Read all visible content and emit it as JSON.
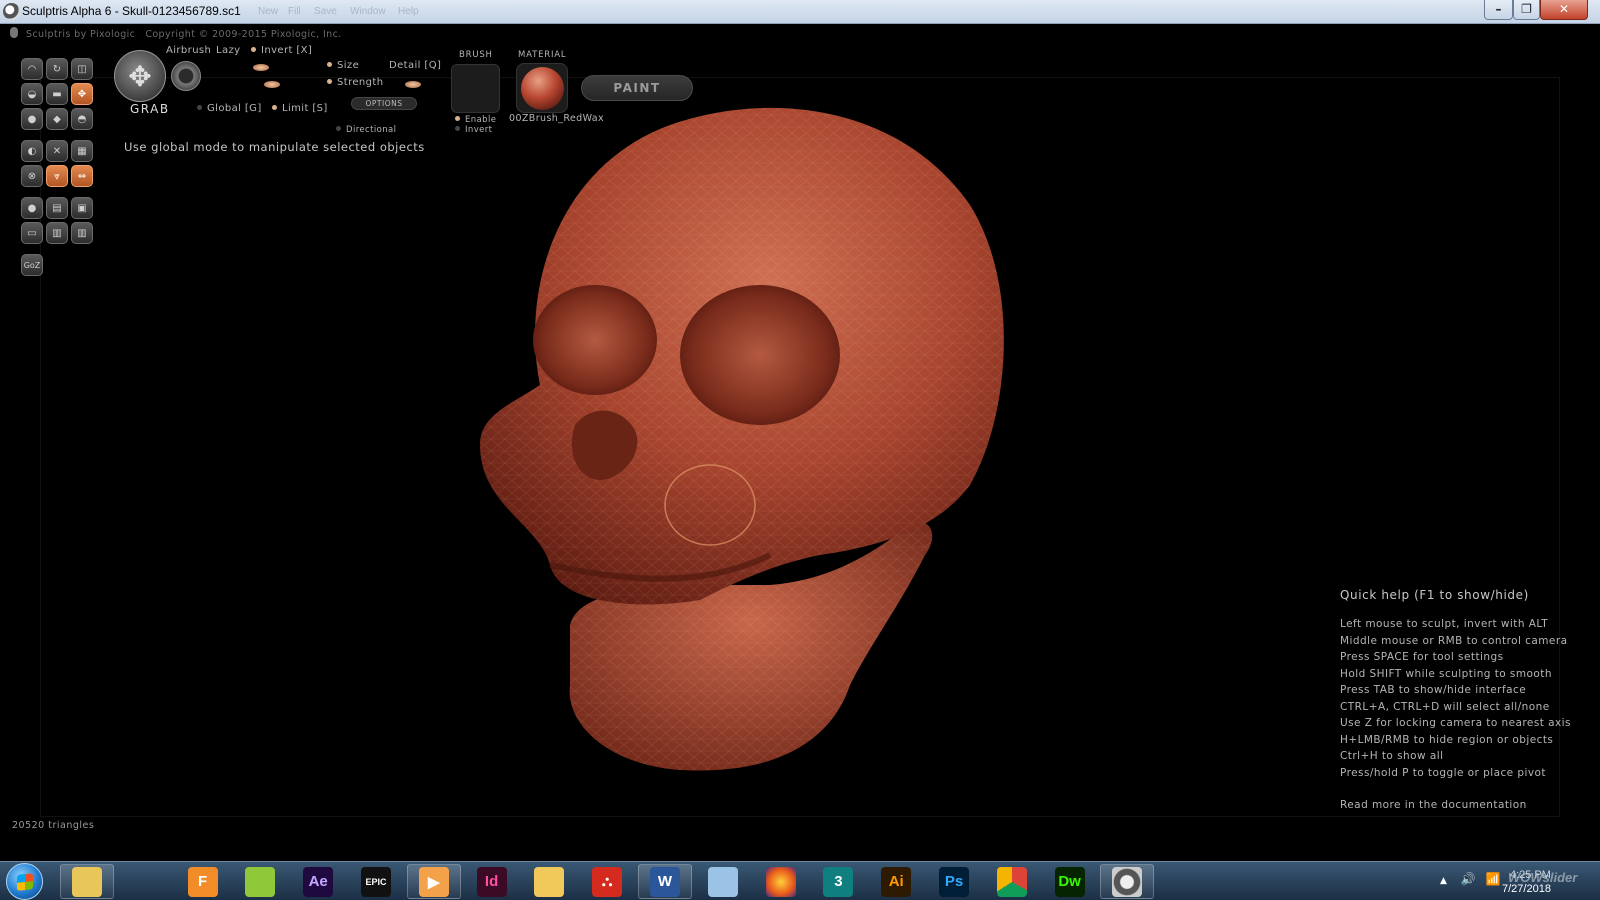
{
  "window": {
    "title": "Sculptris Alpha 6 - Skull-0123456789.sc1",
    "ghost_menu": [
      "New",
      "Fill",
      "Save",
      "Window",
      "Help"
    ],
    "minimize_glyph": "–",
    "maximize_glyph": "❐",
    "close_glyph": "✕"
  },
  "app": {
    "credit_name": "Sculptris by Pixologic",
    "credit_copyright": "Copyright © 2009-2015 Pixologic, Inc."
  },
  "brush_panel": {
    "tool_name": "GRAB",
    "airbrush": "Airbrush",
    "lazy": "Lazy",
    "invert": "Invert [X]",
    "size": "Size",
    "strength": "Strength",
    "detail": "Detail [Q]",
    "global": "Global [G]",
    "limit": "Limit [S]",
    "options": "OPTIONS",
    "directional": "Directional",
    "brush_header": "BRUSH",
    "material_header": "MATERIAL",
    "enable": "Enable",
    "invert_brush": "Invert",
    "material_name": "00ZBrush_RedWax",
    "paint": "PAINT",
    "hint": "Use global mode to manipulate selected objects"
  },
  "tools": {
    "goz": "GoZ"
  },
  "quick_help": {
    "title": "Quick help (F1 to show/hide)",
    "lines": [
      "Left mouse to sculpt, invert with ALT",
      "Middle mouse or RMB to control camera",
      "Press SPACE for tool settings",
      "Hold SHIFT while sculpting to smooth",
      "Press TAB to show/hide interface",
      "CTRL+A, CTRL+D will select all/none",
      "Use Z for locking camera to nearest axis",
      "H+LMB/RMB to hide region or objects",
      "Ctrl+H to show all",
      "Press/hold P to toggle or place pivot"
    ],
    "doc_link": "Read more in the documentation"
  },
  "status": {
    "triangles": "20520 triangles"
  },
  "colors": {
    "accent_orange": "#d9753c",
    "wax_red": "#b84631",
    "taskbar": "#1b2f45"
  },
  "taskbar": {
    "apps": [
      {
        "name": "file-explorer-icon",
        "label": "",
        "bg": "#e8c65a",
        "fg": "#6a4b10"
      },
      {
        "name": "3d-builder-icon",
        "label": "",
        "bg": "transparent",
        "fg": "#ddd"
      },
      {
        "name": "fusion-icon",
        "label": "F",
        "bg": "#f28c28",
        "fg": "#fff"
      },
      {
        "name": "photos-icon",
        "label": "",
        "bg": "#8fc93a",
        "fg": "#fff"
      },
      {
        "name": "after-effects-icon",
        "label": "Ae",
        "bg": "#1f0a40",
        "fg": "#c9a6ff"
      },
      {
        "name": "epic-games-icon",
        "label": "EPIC",
        "bg": "#111",
        "fg": "#fff"
      },
      {
        "name": "media-player-icon",
        "label": "▶",
        "bg": "#f3a24a",
        "fg": "#fff"
      },
      {
        "name": "indesign-icon",
        "label": "Id",
        "bg": "#3b0a24",
        "fg": "#ff4fa2"
      },
      {
        "name": "folder-icon",
        "label": "",
        "bg": "#f1c95b",
        "fg": "#fff"
      },
      {
        "name": "acrobat-icon",
        "label": "⛬",
        "bg": "#d52b1e",
        "fg": "#fff"
      },
      {
        "name": "word-icon",
        "label": "W",
        "bg": "#2b579a",
        "fg": "#fff"
      },
      {
        "name": "pictures-icon",
        "label": "",
        "bg": "#9bc3e6",
        "fg": "#fff"
      },
      {
        "name": "firefox-icon",
        "label": "",
        "bg": "radial-gradient(circle,#ffcf3a,#e8571b 60%,#3b2a8c)",
        "fg": "#fff"
      },
      {
        "name": "3ds-max-icon",
        "label": "3",
        "bg": "#0f7f80",
        "fg": "#fff"
      },
      {
        "name": "illustrator-icon",
        "label": "Ai",
        "bg": "#2e1a00",
        "fg": "#ff9a00"
      },
      {
        "name": "photoshop-icon",
        "label": "Ps",
        "bg": "#001e36",
        "fg": "#31a8ff"
      },
      {
        "name": "chrome-icon",
        "label": "",
        "bg": "conic-gradient(#db4437 0 33%,#0f9d58 0 66%,#f4b400 0)",
        "fg": "#fff"
      },
      {
        "name": "dreamweaver-icon",
        "label": "Dw",
        "bg": "#072401",
        "fg": "#35fa00"
      },
      {
        "name": "sculptris-icon",
        "label": "",
        "bg": "radial-gradient(circle,#eee 0 30%,#555 35% 60%,#ccc 65%)",
        "fg": "#fff"
      }
    ],
    "clock_time": "4:25 PM",
    "clock_date": "7/27/2018",
    "tray_arrow": "▲",
    "tray_volume": "🔊",
    "tray_signal": "📶",
    "watermark": "WOWslider"
  }
}
